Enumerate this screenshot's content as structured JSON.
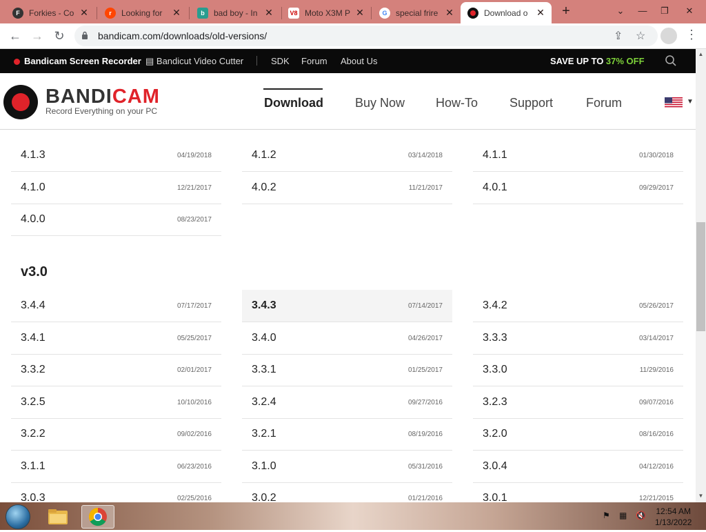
{
  "browser": {
    "tabs": [
      {
        "title": "Forkies - Co",
        "icon": "forkies-icon"
      },
      {
        "title": "Looking for",
        "icon": "reddit-icon"
      },
      {
        "title": "bad boy - In",
        "icon": "page-icon"
      },
      {
        "title": "Moto X3M P",
        "icon": "game-icon"
      },
      {
        "title": "special frire",
        "icon": "google-icon"
      },
      {
        "title": "Download o",
        "icon": "bandicam-icon"
      }
    ],
    "url": "bandicam.com/downloads/old-versions/"
  },
  "topbar": {
    "items": [
      "Bandicam Screen Recorder",
      "Bandicut Video Cutter",
      "SDK",
      "Forum",
      "About Us"
    ],
    "save_prefix": "SAVE UP TO ",
    "save_value": "37% OFF"
  },
  "header": {
    "logo_main": "BANDI",
    "logo_accent": "CAM",
    "tagline": "Record Everything on your PC",
    "nav": [
      "Download",
      "Buy Now",
      "How-To",
      "Support",
      "Forum"
    ]
  },
  "versions_v4_partial": [
    {
      "ver": "4.1.3",
      "date": "04/19/2018"
    },
    {
      "ver": "4.1.2",
      "date": "03/14/2018"
    },
    {
      "ver": "4.1.1",
      "date": "01/30/2018"
    },
    {
      "ver": "4.1.0",
      "date": "12/21/2017"
    },
    {
      "ver": "4.0.2",
      "date": "11/21/2017"
    },
    {
      "ver": "4.0.1",
      "date": "09/29/2017"
    },
    {
      "ver": "4.0.0",
      "date": "08/23/2017"
    }
  ],
  "section_v3_title": "v3.0",
  "versions_v3": [
    {
      "ver": "3.4.4",
      "date": "07/17/2017"
    },
    {
      "ver": "3.4.3",
      "date": "07/14/2017"
    },
    {
      "ver": "3.4.2",
      "date": "05/26/2017"
    },
    {
      "ver": "3.4.1",
      "date": "05/25/2017"
    },
    {
      "ver": "3.4.0",
      "date": "04/26/2017"
    },
    {
      "ver": "3.3.3",
      "date": "03/14/2017"
    },
    {
      "ver": "3.3.2",
      "date": "02/01/2017"
    },
    {
      "ver": "3.3.1",
      "date": "01/25/2017"
    },
    {
      "ver": "3.3.0",
      "date": "11/29/2016"
    },
    {
      "ver": "3.2.5",
      "date": "10/10/2016"
    },
    {
      "ver": "3.2.4",
      "date": "09/27/2016"
    },
    {
      "ver": "3.2.3",
      "date": "09/07/2016"
    },
    {
      "ver": "3.2.2",
      "date": "09/02/2016"
    },
    {
      "ver": "3.2.1",
      "date": "08/19/2016"
    },
    {
      "ver": "3.2.0",
      "date": "08/16/2016"
    },
    {
      "ver": "3.1.1",
      "date": "06/23/2016"
    },
    {
      "ver": "3.1.0",
      "date": "05/31/2016"
    },
    {
      "ver": "3.0.4",
      "date": "04/12/2016"
    },
    {
      "ver": "3.0.3",
      "date": "02/25/2016"
    },
    {
      "ver": "3.0.2",
      "date": "01/21/2016"
    },
    {
      "ver": "3.0.1",
      "date": "12/21/2015"
    }
  ],
  "taskbar": {
    "time": "12:54 AM",
    "date": "1/13/2022"
  }
}
